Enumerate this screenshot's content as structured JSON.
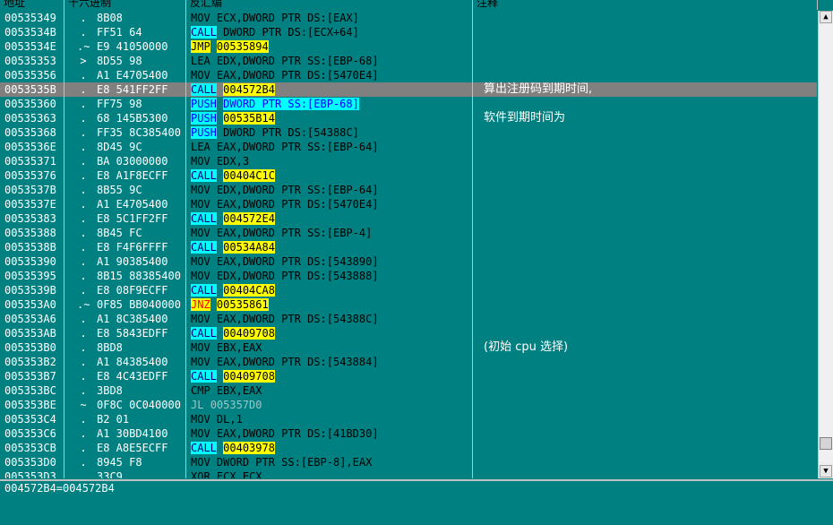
{
  "header": {
    "address": "地址",
    "hex": "十六进制",
    "disasm": "反汇编",
    "comment": "注释"
  },
  "rows": [
    {
      "addr": "00535349",
      "mark": ".",
      "hex": "8B08",
      "mn": "MOV",
      "mk": "mov",
      "ops": "ECX,DWORD PTR DS:[EAX]",
      "ok": "mixed"
    },
    {
      "addr": "0053534B",
      "mark": ".",
      "hex": "FF51 64",
      "mn": "CALL",
      "mk": "call",
      "ops": "DWORD PTR DS:[ECX+64]",
      "ok": "plain"
    },
    {
      "addr": "0053534E",
      "mark": ".~",
      "hex": "E9 41050000",
      "mn": "JMP",
      "mk": "jmp",
      "ops": "00535894",
      "ok": "target"
    },
    {
      "addr": "00535353",
      "mark": ">",
      "hex": "8D55 98",
      "mn": "LEA",
      "mk": "lea",
      "ops": "EDX,DWORD PTR SS:[EBP-68]",
      "ok": "mixed"
    },
    {
      "addr": "00535356",
      "mark": ".",
      "hex": "A1 E4705400",
      "mn": "MOV",
      "mk": "mov",
      "ops": "EAX,DWORD PTR DS:[5470E4]",
      "ok": "mixed"
    },
    {
      "addr": "0053535B",
      "mark": ".",
      "hex": "E8 541FF2FF",
      "mn": "CALL",
      "mk": "call",
      "ops": "004572B4",
      "ok": "target",
      "sel": true,
      "comment": "算出注册码到期时间,"
    },
    {
      "addr": "00535360",
      "mark": ".",
      "hex": "FF75 98",
      "mn": "PUSH",
      "mk": "push",
      "ops": "DWORD PTR SS:[EBP-68]",
      "ok": "mem"
    },
    {
      "addr": "00535363",
      "mark": ".",
      "hex": "68 145B5300",
      "mn": "PUSH",
      "mk": "push",
      "ops": "00535B14",
      "ok": "target",
      "comment": "软件到期时间为"
    },
    {
      "addr": "00535368",
      "mark": ".",
      "hex": "FF35 8C385400",
      "mn": "PUSH",
      "mk": "push",
      "ops": "DWORD PTR DS:[54388C]",
      "ok": "plain"
    },
    {
      "addr": "0053536E",
      "mark": ".",
      "hex": "8D45 9C",
      "mn": "LEA",
      "mk": "lea",
      "ops": "EAX,DWORD PTR SS:[EBP-64]",
      "ok": "mixed"
    },
    {
      "addr": "00535371",
      "mark": ".",
      "hex": "BA 03000000",
      "mn": "MOV",
      "mk": "mov",
      "ops": "EDX,3",
      "ok": "plain"
    },
    {
      "addr": "00535376",
      "mark": ".",
      "hex": "E8 A1F8ECFF",
      "mn": "CALL",
      "mk": "call",
      "ops": "00404C1C",
      "ok": "target"
    },
    {
      "addr": "0053537B",
      "mark": ".",
      "hex": "8B55 9C",
      "mn": "MOV",
      "mk": "mov",
      "ops": "EDX,DWORD PTR SS:[EBP-64]",
      "ok": "mixed"
    },
    {
      "addr": "0053537E",
      "mark": ".",
      "hex": "A1 E4705400",
      "mn": "MOV",
      "mk": "mov",
      "ops": "EAX,DWORD PTR DS:[5470E4]",
      "ok": "mixed"
    },
    {
      "addr": "00535383",
      "mark": ".",
      "hex": "E8 5C1FF2FF",
      "mn": "CALL",
      "mk": "call",
      "ops": "004572E4",
      "ok": "target"
    },
    {
      "addr": "00535388",
      "mark": ".",
      "hex": "8B45 FC",
      "mn": "MOV",
      "mk": "mov",
      "ops": "EAX,DWORD PTR SS:[EBP-4]",
      "ok": "mixed"
    },
    {
      "addr": "0053538B",
      "mark": ".",
      "hex": "E8 F4F6FFFF",
      "mn": "CALL",
      "mk": "call",
      "ops": "00534A84",
      "ok": "target"
    },
    {
      "addr": "00535390",
      "mark": ".",
      "hex": "A1 90385400",
      "mn": "MOV",
      "mk": "mov",
      "ops": "EAX,DWORD PTR DS:[543890]",
      "ok": "mixed"
    },
    {
      "addr": "00535395",
      "mark": ".",
      "hex": "8B15 88385400",
      "mn": "MOV",
      "mk": "mov",
      "ops": "EDX,DWORD PTR DS:[543888]",
      "ok": "mixed"
    },
    {
      "addr": "0053539B",
      "mark": ".",
      "hex": "E8 08F9ECFF",
      "mn": "CALL",
      "mk": "call",
      "ops": "00404CA8",
      "ok": "target"
    },
    {
      "addr": "005353A0",
      "mark": ".~",
      "hex": "0F85 BB040000",
      "mn": "JNZ",
      "mk": "jnz",
      "ops": "00535861",
      "ok": "target"
    },
    {
      "addr": "005353A6",
      "mark": ".",
      "hex": "A1 8C385400",
      "mn": "MOV",
      "mk": "mov",
      "ops": "EAX,DWORD PTR DS:[54388C]",
      "ok": "mixed"
    },
    {
      "addr": "005353AB",
      "mark": ".",
      "hex": "E8 5843EDFF",
      "mn": "CALL",
      "mk": "call",
      "ops": "00409708",
      "ok": "target"
    },
    {
      "addr": "005353B0",
      "mark": ".",
      "hex": "8BD8",
      "mn": "MOV",
      "mk": "mov",
      "ops": "EBX,EAX",
      "ok": "plain",
      "comment": "(初始 cpu 选择)"
    },
    {
      "addr": "005353B2",
      "mark": ".",
      "hex": "A1 84385400",
      "mn": "MOV",
      "mk": "mov",
      "ops": "EAX,DWORD PTR DS:[543884]",
      "ok": "mixed"
    },
    {
      "addr": "005353B7",
      "mark": ".",
      "hex": "E8 4C43EDFF",
      "mn": "CALL",
      "mk": "call",
      "ops": "00409708",
      "ok": "target"
    },
    {
      "addr": "005353BC",
      "mark": ".",
      "hex": "3BD8",
      "mn": "CMP",
      "mk": "cmp",
      "ops": "EBX,EAX",
      "ok": "plain"
    },
    {
      "addr": "005353BE",
      "mark": "~",
      "hex": "0F8C 0C040000",
      "mn": "JL",
      "mk": "jl",
      "ops": "005357D0",
      "ok": "plain",
      "dim": true
    },
    {
      "addr": "005353C4",
      "mark": ".",
      "hex": "B2 01",
      "mn": "MOV",
      "mk": "mov",
      "ops": "DL,1",
      "ok": "plain"
    },
    {
      "addr": "005353C6",
      "mark": ".",
      "hex": "A1 30BD4100",
      "mn": "MOV",
      "mk": "mov",
      "ops": "EAX,DWORD PTR DS:[41BD30]",
      "ok": "mixed"
    },
    {
      "addr": "005353CB",
      "mark": ".",
      "hex": "E8 A8E5ECFF",
      "mn": "CALL",
      "mk": "call",
      "ops": "00403978",
      "ok": "target"
    },
    {
      "addr": "005353D0",
      "mark": ".",
      "hex": "8945 F8",
      "mn": "MOV",
      "mk": "mov",
      "ops": "DWORD PTR SS:[EBP-8],EAX",
      "ok": "mixed"
    },
    {
      "addr": "005353D3",
      "mark": ".",
      "hex": "33C9",
      "mn": "XOR",
      "mk": "mov",
      "ops": "ECX,ECX",
      "ok": "plain"
    }
  ],
  "info_line": "004572B4=004572B4",
  "colors": {
    "bg": "#008080",
    "selected": "#808080",
    "call_bg": "#00ffff",
    "jump_bg": "#ffff00"
  }
}
